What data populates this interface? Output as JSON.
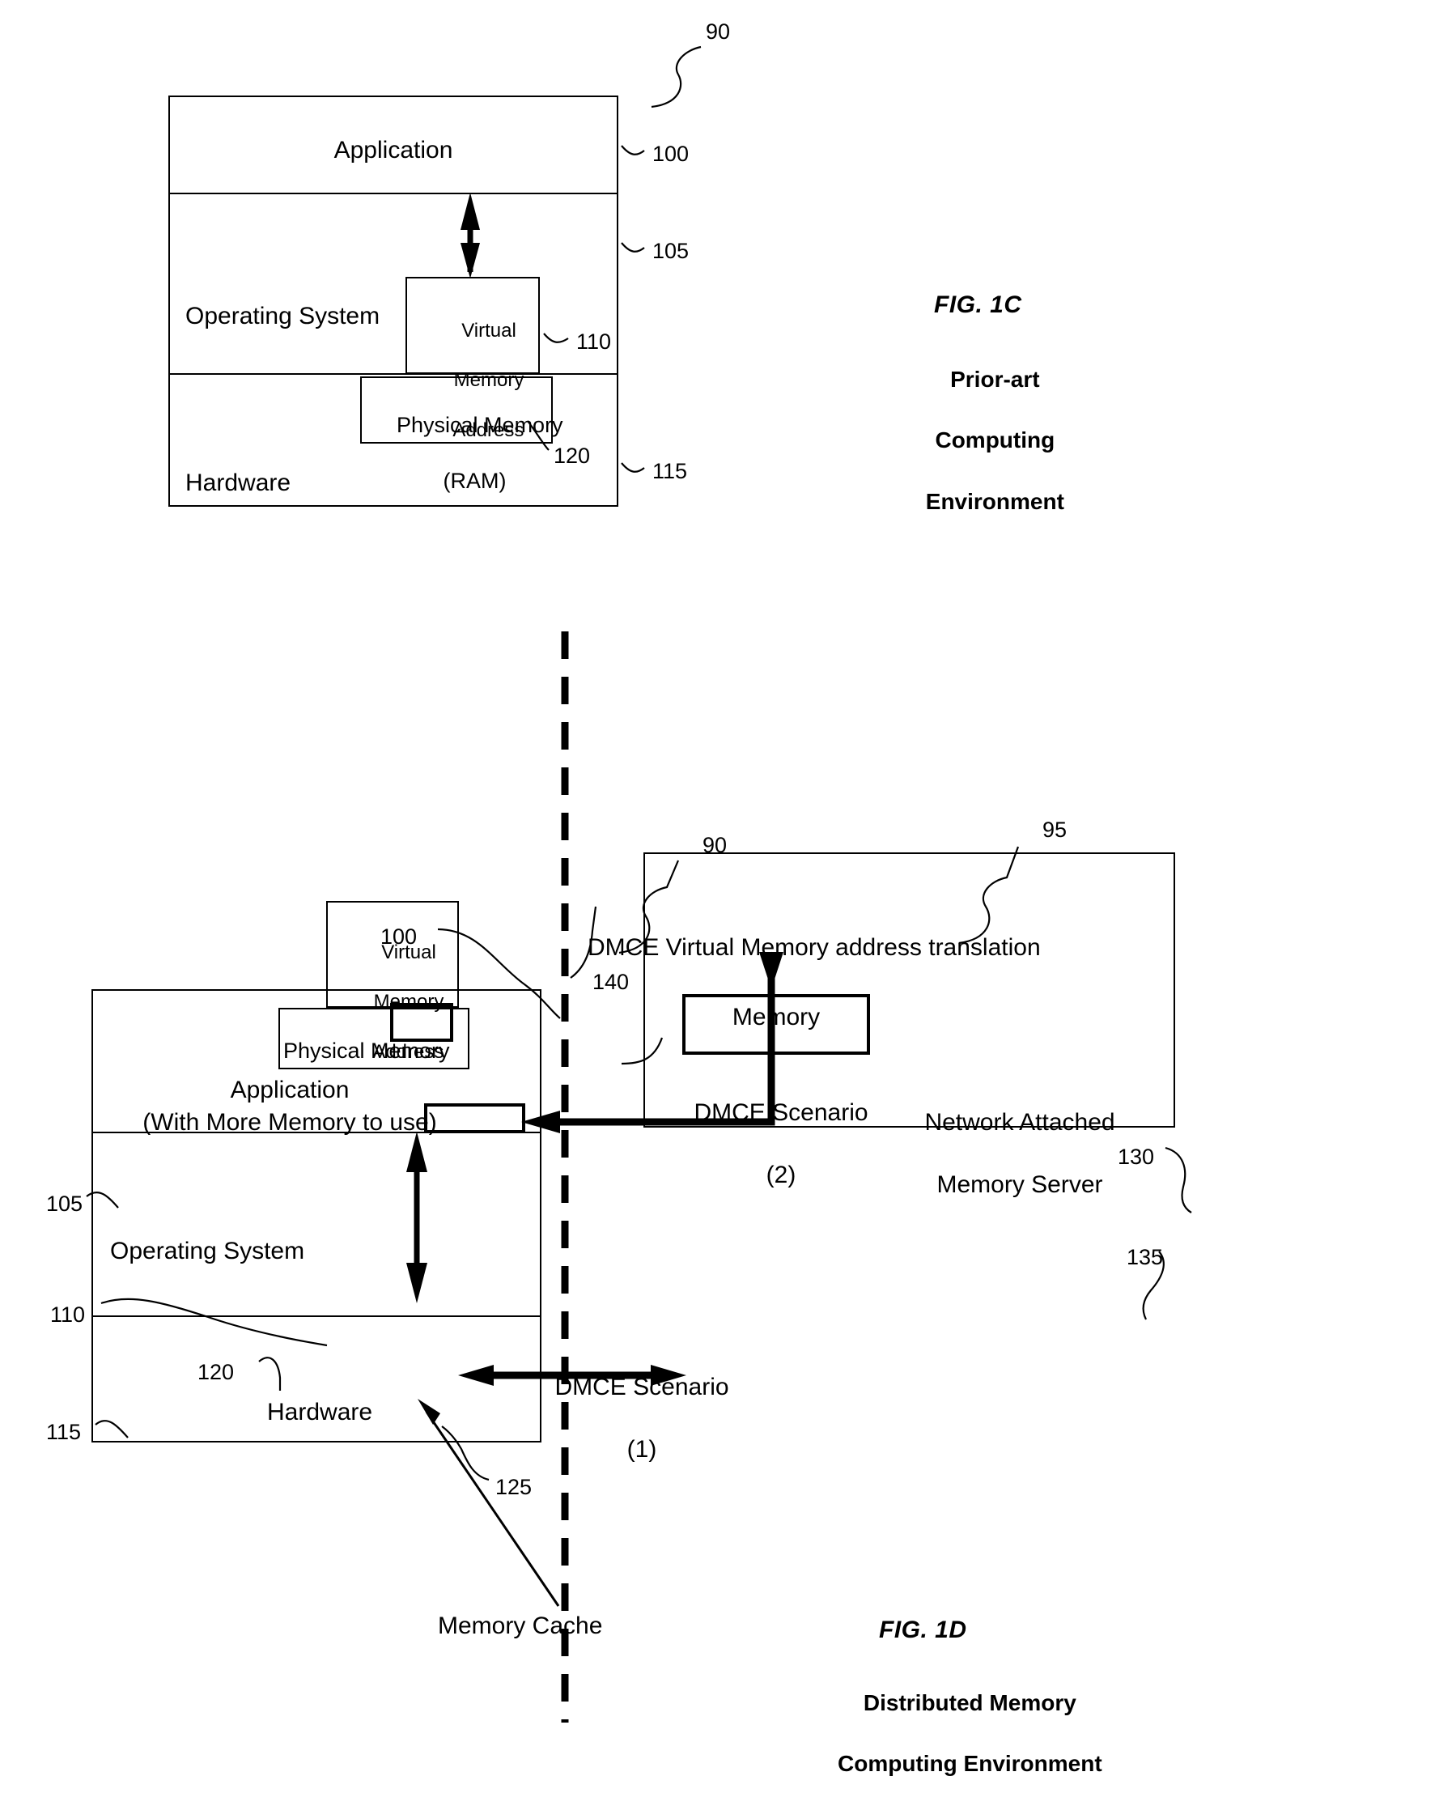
{
  "figures": [
    {
      "id": "fig-1c",
      "caption_title": "FIG. 1C",
      "caption_lines": [
        "Prior-art",
        "Computing",
        "Environment"
      ],
      "refs": {
        "env": "90",
        "application": "100",
        "operating_system": "105",
        "virtual_memory_address": "110",
        "physical_memory": "120",
        "hardware": "115"
      },
      "blocks": {
        "application": "Application",
        "operating_system": "Operating System",
        "virtual_memory_address": [
          "Virtual",
          "Memory",
          "Address"
        ],
        "physical_memory": [
          "Physical Memory",
          "(RAM)"
        ],
        "hardware": "Hardware"
      }
    },
    {
      "id": "fig-1d",
      "caption_title": "FIG. 1D",
      "caption_lines": [
        "Distributed Memory",
        "Computing Environment"
      ],
      "refs": {
        "client_env": "90",
        "server_env": "95",
        "application": "100",
        "operating_system": "105",
        "virtual_memory_address": "110",
        "hardware": "115",
        "physical_memory": "120",
        "memory_cache": "125",
        "network_attached_memory_server": "130",
        "memory": "135",
        "dmce_translation": "140"
      },
      "blocks": {
        "application_line1": "Application",
        "application_line2": "(With More Memory to use)",
        "operating_system": "Operating System",
        "virtual_memory_address": [
          "Virtual",
          "Memory",
          "Address"
        ],
        "physical_memory": "Physical Memory",
        "hardware": "Hardware",
        "memory": "Memory",
        "network_attached_memory_server": [
          "Network Attached",
          "Memory Server"
        ]
      },
      "annotations": {
        "dmce_translation": "DMCE Virtual Memory address translation",
        "dmce_scenario_2_line1": "DMCE Scenario",
        "dmce_scenario_2_line2": "(2)",
        "dmce_scenario_1_line1": "DMCE Scenario",
        "dmce_scenario_1_line2": "(1)",
        "memory_cache": "Memory Cache"
      }
    }
  ]
}
